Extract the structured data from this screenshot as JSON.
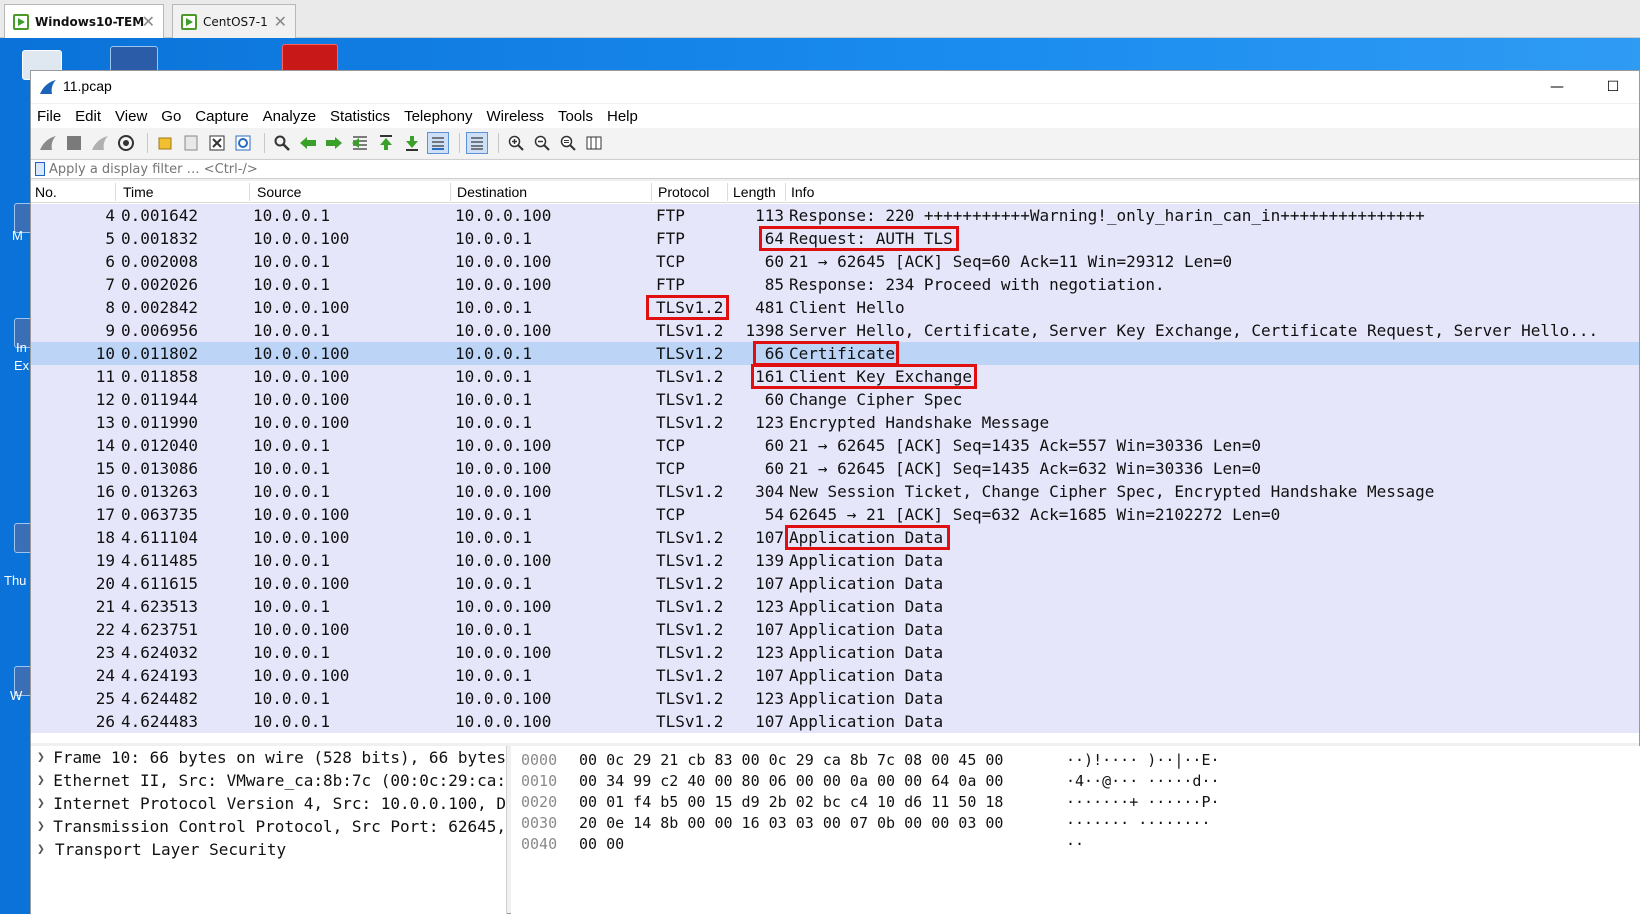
{
  "vm_tabs": [
    {
      "label": "Windows10-TEM",
      "close": "✕"
    },
    {
      "label": "CentOS7-1",
      "close": "✕"
    }
  ],
  "desktop_labels": [
    "M",
    "In",
    "Ex",
    "Thu",
    "W"
  ],
  "window": {
    "title": "11.pcap",
    "minimize": "—",
    "maximize": "☐"
  },
  "menu": [
    "File",
    "Edit",
    "View",
    "Go",
    "Capture",
    "Analyze",
    "Statistics",
    "Telephony",
    "Wireless",
    "Tools",
    "Help"
  ],
  "filter": {
    "placeholder": "Apply a display filter … <Ctrl-/>"
  },
  "columns": [
    "No.",
    "Time",
    "Source",
    "Destination",
    "Protocol",
    "Length",
    "Info"
  ],
  "packets": [
    {
      "no": "4",
      "time": "0.001642",
      "src": "10.0.0.1",
      "dst": "10.0.0.100",
      "proto": "FTP",
      "len": "113",
      "info": "Response: 220 +++++++++++Warning!_only_harin_can_in+++++++++++++++"
    },
    {
      "no": "5",
      "time": "0.001832",
      "src": "10.0.0.100",
      "dst": "10.0.0.1",
      "proto": "FTP",
      "len": "64",
      "info": "Request: AUTH TLS"
    },
    {
      "no": "6",
      "time": "0.002008",
      "src": "10.0.0.1",
      "dst": "10.0.0.100",
      "proto": "TCP",
      "len": "60",
      "info": "21 → 62645 [ACK] Seq=60 Ack=11 Win=29312 Len=0"
    },
    {
      "no": "7",
      "time": "0.002026",
      "src": "10.0.0.1",
      "dst": "10.0.0.100",
      "proto": "FTP",
      "len": "85",
      "info": "Response: 234 Proceed with negotiation."
    },
    {
      "no": "8",
      "time": "0.002842",
      "src": "10.0.0.100",
      "dst": "10.0.0.1",
      "proto": "TLSv1.2",
      "len": "481",
      "info": "Client Hello"
    },
    {
      "no": "9",
      "time": "0.006956",
      "src": "10.0.0.1",
      "dst": "10.0.0.100",
      "proto": "TLSv1.2",
      "len": "1398",
      "info": "Server Hello, Certificate, Server Key Exchange, Certificate Request, Server Hello..."
    },
    {
      "no": "10",
      "time": "0.011802",
      "src": "10.0.0.100",
      "dst": "10.0.0.1",
      "proto": "TLSv1.2",
      "len": "66",
      "info": "Certificate"
    },
    {
      "no": "11",
      "time": "0.011858",
      "src": "10.0.0.100",
      "dst": "10.0.0.1",
      "proto": "TLSv1.2",
      "len": "161",
      "info": "Client Key Exchange"
    },
    {
      "no": "12",
      "time": "0.011944",
      "src": "10.0.0.100",
      "dst": "10.0.0.1",
      "proto": "TLSv1.2",
      "len": "60",
      "info": "Change Cipher Spec"
    },
    {
      "no": "13",
      "time": "0.011990",
      "src": "10.0.0.100",
      "dst": "10.0.0.1",
      "proto": "TLSv1.2",
      "len": "123",
      "info": "Encrypted Handshake Message"
    },
    {
      "no": "14",
      "time": "0.012040",
      "src": "10.0.0.1",
      "dst": "10.0.0.100",
      "proto": "TCP",
      "len": "60",
      "info": "21 → 62645 [ACK] Seq=1435 Ack=557 Win=30336 Len=0"
    },
    {
      "no": "15",
      "time": "0.013086",
      "src": "10.0.0.1",
      "dst": "10.0.0.100",
      "proto": "TCP",
      "len": "60",
      "info": "21 → 62645 [ACK] Seq=1435 Ack=632 Win=30336 Len=0"
    },
    {
      "no": "16",
      "time": "0.013263",
      "src": "10.0.0.1",
      "dst": "10.0.0.100",
      "proto": "TLSv1.2",
      "len": "304",
      "info": "New Session Ticket, Change Cipher Spec, Encrypted Handshake Message"
    },
    {
      "no": "17",
      "time": "0.063735",
      "src": "10.0.0.100",
      "dst": "10.0.0.1",
      "proto": "TCP",
      "len": "54",
      "info": "62645 → 21 [ACK] Seq=632 Ack=1685 Win=2102272 Len=0"
    },
    {
      "no": "18",
      "time": "4.611104",
      "src": "10.0.0.100",
      "dst": "10.0.0.1",
      "proto": "TLSv1.2",
      "len": "107",
      "info": "Application Data"
    },
    {
      "no": "19",
      "time": "4.611485",
      "src": "10.0.0.1",
      "dst": "10.0.0.100",
      "proto": "TLSv1.2",
      "len": "139",
      "info": "Application Data"
    },
    {
      "no": "20",
      "time": "4.611615",
      "src": "10.0.0.100",
      "dst": "10.0.0.1",
      "proto": "TLSv1.2",
      "len": "107",
      "info": "Application Data"
    },
    {
      "no": "21",
      "time": "4.623513",
      "src": "10.0.0.1",
      "dst": "10.0.0.100",
      "proto": "TLSv1.2",
      "len": "123",
      "info": "Application Data"
    },
    {
      "no": "22",
      "time": "4.623751",
      "src": "10.0.0.100",
      "dst": "10.0.0.1",
      "proto": "TLSv1.2",
      "len": "107",
      "info": "Application Data"
    },
    {
      "no": "23",
      "time": "4.624032",
      "src": "10.0.0.1",
      "dst": "10.0.0.100",
      "proto": "TLSv1.2",
      "len": "123",
      "info": "Application Data"
    },
    {
      "no": "24",
      "time": "4.624193",
      "src": "10.0.0.100",
      "dst": "10.0.0.1",
      "proto": "TLSv1.2",
      "len": "107",
      "info": "Application Data"
    },
    {
      "no": "25",
      "time": "4.624482",
      "src": "10.0.0.1",
      "dst": "10.0.0.100",
      "proto": "TLSv1.2",
      "len": "123",
      "info": "Application Data"
    },
    {
      "no": "26",
      "time": "4.624483",
      "src": "10.0.0.1",
      "dst": "10.0.0.100",
      "proto": "TLSv1.2",
      "len": "107",
      "info": "Application Data"
    }
  ],
  "selected_packet": "10",
  "details": [
    "Frame 10: 66 bytes on wire (528 bits), 66 bytes",
    "Ethernet II, Src: VMware_ca:8b:7c (00:0c:29:ca:",
    "Internet Protocol Version 4, Src: 10.0.0.100, D",
    "Transmission Control Protocol, Src Port: 62645,",
    "Transport Layer Security"
  ],
  "bytes": [
    {
      "offset": "0000",
      "hex": "00 0c 29 21 cb 83 00 0c  29 ca 8b 7c 08 00 45 00",
      "ascii": "··)!····  )··|··E·"
    },
    {
      "offset": "0010",
      "hex": "00 34 99 c2 40 00 80 06  00 00 0a 00 00 64 0a 00",
      "ascii": "·4··@···  ·····d··"
    },
    {
      "offset": "0020",
      "hex": "00 01 f4 b5 00 15 d9 2b  02 bc c4 10 d6 11 50 18",
      "ascii": "·······+  ······P·"
    },
    {
      "offset": "0030",
      "hex": "20 0e 14 8b 00 00 16 03  03 00 07 0b 00 00 03 00",
      "ascii": " ·······  ········"
    },
    {
      "offset": "0040",
      "hex": "00 00",
      "ascii": "··"
    }
  ],
  "colors": {
    "row_bg": "#e6e6fa",
    "selected_bg": "#bcd5f6",
    "highlight": "#e01010",
    "desktop": "#1a8cf0"
  }
}
